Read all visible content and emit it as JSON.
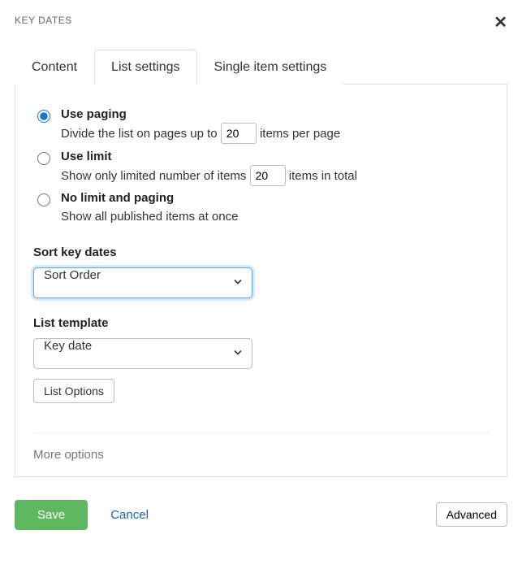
{
  "header": {
    "title": "KEY DATES"
  },
  "tabs": {
    "content": "Content",
    "list_settings": "List settings",
    "single_item": "Single item settings"
  },
  "paging": {
    "use_paging": {
      "label": "Use paging",
      "desc_pre": "Divide the list on pages up to ",
      "value": "20",
      "desc_post": " items per page",
      "checked": true
    },
    "use_limit": {
      "label": "Use limit",
      "desc_pre": "Show only limited number of items ",
      "value": "20",
      "desc_post": " items in total",
      "checked": false
    },
    "no_limit": {
      "label": "No limit and paging",
      "desc": "Show all published items at once",
      "checked": false
    }
  },
  "sort": {
    "label": "Sort key dates",
    "selected": "Sort Order"
  },
  "template": {
    "label": "List template",
    "selected": "Key date",
    "options_button": "List Options"
  },
  "more_options": "More options",
  "footer": {
    "save": "Save",
    "cancel": "Cancel",
    "advanced": "Advanced"
  }
}
